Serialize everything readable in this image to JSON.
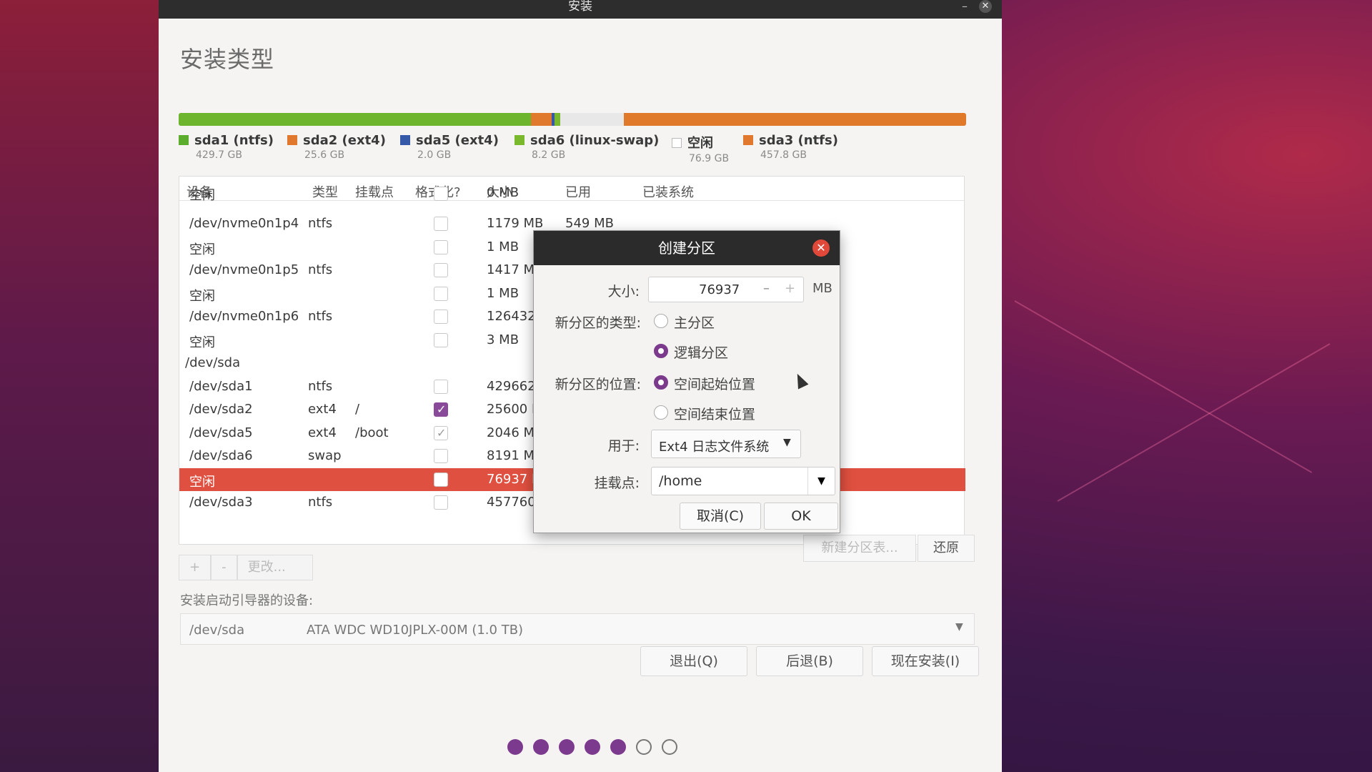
{
  "window": {
    "title": "安装",
    "minimize": "–",
    "close": "✕"
  },
  "page_title": "安装类型",
  "partition_bar": [
    {
      "color": "#6cb52d",
      "fraction": 0.447
    },
    {
      "color": "#e0792e",
      "fraction": 0.027
    },
    {
      "color": "#3558a8",
      "fraction": 0.003
    },
    {
      "color": "#7ab82e",
      "fraction": 0.008
    },
    {
      "color": "#e8e8e8",
      "fraction": 0.08
    },
    {
      "color": "#e07a2a",
      "fraction": 0.435
    }
  ],
  "legend": [
    {
      "name": "sda1 (ntfs)",
      "size": "429.7 GB",
      "color": "#5cad2e"
    },
    {
      "name": "sda2 (ext4)",
      "size": "25.6 GB",
      "color": "#e0792e"
    },
    {
      "name": "sda5 (ext4)",
      "size": "2.0 GB",
      "color": "#3558a8"
    },
    {
      "name": "sda6 (linux-swap)",
      "size": "8.2 GB",
      "color": "#7ab82e"
    },
    {
      "name": "空闲",
      "size": "76.9 GB",
      "color": "#ffffff"
    },
    {
      "name": "sda3 (ntfs)",
      "size": "457.8 GB",
      "color": "#e0792e"
    }
  ],
  "table": {
    "headers": {
      "device": "设备",
      "type": "类型",
      "mount": "挂载点",
      "format": "格式化?",
      "size": "大小",
      "used": "已用",
      "system": "已装系统"
    },
    "rows": [
      {
        "device": "空闲",
        "type": "",
        "mount": "",
        "size": "0 MB",
        "used": "",
        "checked": false
      },
      {
        "device": "/dev/nvme0n1p4",
        "type": "ntfs",
        "mount": "",
        "size": "1179 MB",
        "used": "549 MB",
        "checked": false
      },
      {
        "device": "空闲",
        "type": "",
        "mount": "",
        "size": "1 MB",
        "used": "",
        "checked": false
      },
      {
        "device": "/dev/nvme0n1p5",
        "type": "ntfs",
        "mount": "",
        "size": "1417 M",
        "used": "",
        "checked": false
      },
      {
        "device": "空闲",
        "type": "",
        "mount": "",
        "size": "1 MB",
        "used": "",
        "checked": false
      },
      {
        "device": "/dev/nvme0n1p6",
        "type": "ntfs",
        "mount": "",
        "size": "126432",
        "used": "",
        "checked": false
      },
      {
        "device": "空闲",
        "type": "",
        "mount": "",
        "size": "3 MB",
        "used": "",
        "checked": false
      },
      {
        "device": "/dev/sda",
        "type": "",
        "mount": "",
        "size": "",
        "used": "",
        "checked": null
      },
      {
        "device": "/dev/sda1",
        "type": "ntfs",
        "mount": "",
        "size": "429662",
        "used": "",
        "checked": false
      },
      {
        "device": "/dev/sda2",
        "type": "ext4",
        "mount": "/",
        "size": "25600 I",
        "used": "",
        "checked": true
      },
      {
        "device": "/dev/sda5",
        "type": "ext4",
        "mount": "/boot",
        "size": "2046 M",
        "used": "",
        "checked": "gray"
      },
      {
        "device": "/dev/sda6",
        "type": "swap",
        "mount": "",
        "size": "8191 M",
        "used": "",
        "checked": false
      },
      {
        "device": "空闲",
        "type": "",
        "mount": "",
        "size": "76937 I",
        "used": "",
        "checked": false,
        "selected": true
      },
      {
        "device": "/dev/sda3",
        "type": "ntfs",
        "mount": "",
        "size": "457760",
        "used": "",
        "checked": false
      }
    ]
  },
  "table_buttons": {
    "add": "+",
    "remove": "-",
    "change": "更改..."
  },
  "new_table_button": "新建分区表...",
  "revert_button": "还原",
  "bootloader": {
    "label": "安装启动引导器的设备:",
    "device": "/dev/sda",
    "desc": "ATA WDC WD10JPLX-00M (1.0 TB)"
  },
  "actions": {
    "quit": "退出(Q)",
    "back": "后退(B)",
    "install": "现在安装(I)"
  },
  "progress": {
    "completed": 5,
    "total": 7
  },
  "dialog": {
    "title": "创建分区",
    "size_label": "大小:",
    "size_value": "76937",
    "size_unit": "MB",
    "spin_minus": "–",
    "spin_plus": "+",
    "type_label": "新分区的类型:",
    "type_primary": "主分区",
    "type_logical": "逻辑分区",
    "location_label": "新分区的位置:",
    "loc_begin": "空间起始位置",
    "loc_end": "空间结束位置",
    "use_label": "用于:",
    "use_value": "Ext4 日志文件系统",
    "mount_label": "挂载点:",
    "mount_value": "/home",
    "cancel": "取消(C)",
    "ok": "OK"
  }
}
